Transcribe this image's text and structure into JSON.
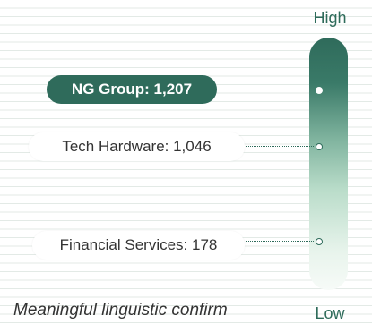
{
  "scale": {
    "high_label": "High",
    "low_label": "Low"
  },
  "items": [
    {
      "label": "NG Group: 1,207",
      "value": 1207,
      "highlighted": true
    },
    {
      "label": "Tech Hardware: 1,046",
      "value": 1046,
      "highlighted": false
    },
    {
      "label": "Financial Services: 178",
      "value": 178,
      "highlighted": false
    }
  ],
  "caption": "Meaningful linguistic confirm",
  "colors": {
    "accent": "#2f6b5b",
    "bar_top": "#2f6b5b",
    "bar_bottom": "#f7fbf8",
    "text": "#333333"
  }
}
